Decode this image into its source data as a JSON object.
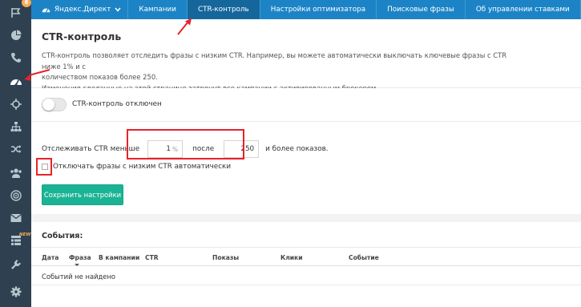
{
  "sidebar": {
    "items": [
      {
        "icon": "flag-icon",
        "badge": "6"
      },
      {
        "icon": "pie-chart-icon"
      },
      {
        "icon": "phone-icon"
      },
      {
        "icon": "dashboard-icon"
      },
      {
        "icon": "crosshair-icon"
      },
      {
        "icon": "sitemap-icon"
      },
      {
        "icon": "shuffle-icon"
      },
      {
        "icon": "users-icon"
      },
      {
        "icon": "target-icon"
      },
      {
        "icon": "envelope-icon"
      },
      {
        "icon": "list-icon",
        "badge": "NEW"
      },
      {
        "icon": "plug-icon"
      },
      {
        "icon": "gear-icon"
      }
    ]
  },
  "topnav": {
    "brand": "Яндекс.Директ",
    "items": [
      "Кампании",
      "CTR-контроль",
      "Настройки оптимизатора",
      "Поисковые фразы",
      "Об управлении ставками"
    ]
  },
  "page": {
    "title": "CTR-контроль",
    "desc_line1": "CTR-контроль позволяет отследить фразы с низким CTR. Например, вы можете автоматически выключать ключевые фразы с CTR ниже 1% и с",
    "desc_line2": "количеством показов более 250.",
    "desc_line3": "Изменения сделанные на этой странице затронут все кампании с активированным брокером."
  },
  "toggle": {
    "label": "CTR-контроль отключен",
    "enabled": false
  },
  "form": {
    "track_label": "Отслеживать CTR меньше",
    "ctr_value": "1",
    "ctr_unit": "%",
    "after_label": "после",
    "views_value": "250",
    "tail_label": "и более показов.",
    "auto_disable_label": "Отключать фразы с низким CTR автоматически",
    "save_label": "Сохранить настройки"
  },
  "events": {
    "title": "События:",
    "columns": [
      "Дата",
      "Фраза",
      "В кампании",
      "CTR",
      "Показы",
      "Клики",
      "Событие"
    ],
    "empty_text": "Событий не найдено"
  },
  "colors": {
    "rail": "#2f4050",
    "nav": "#1c84c6",
    "nav_active": "#15669b",
    "button": "#1ab394",
    "annotation": "#e8222b",
    "badge": "#f8ac59"
  }
}
